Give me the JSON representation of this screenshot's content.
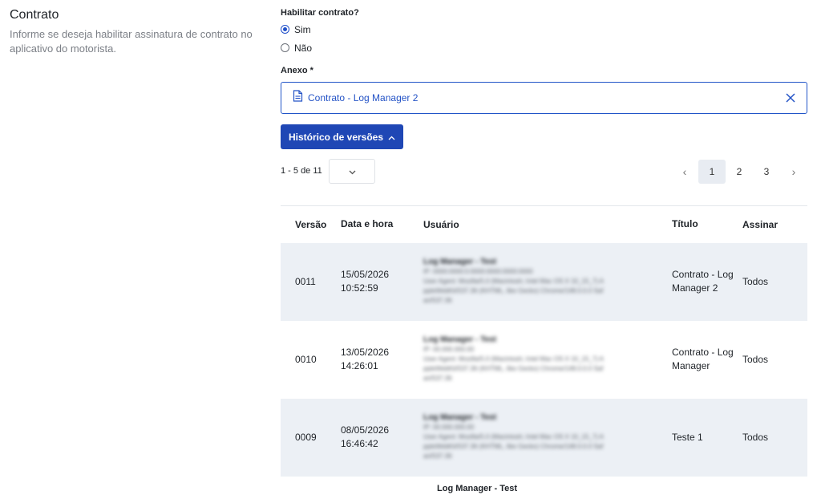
{
  "section": {
    "title": "Contrato",
    "description": "Informe se deseja habilitar assinatura de contrato no aplicativo do motorista."
  },
  "enable": {
    "label": "Habilitar contrato?",
    "options": [
      {
        "label": "Sim",
        "checked": true
      },
      {
        "label": "Não",
        "checked": false
      }
    ]
  },
  "attachment": {
    "label": "Anexo *",
    "file_name": "Contrato - Log Manager 2",
    "icon": "document-icon"
  },
  "history_button": {
    "label": "Histórico de versões",
    "icon": "chevron-up-icon"
  },
  "pagination": {
    "range": "1 - 5 de 11",
    "pages": [
      "1",
      "2",
      "3"
    ],
    "current": "1"
  },
  "table": {
    "headers": [
      "Versão",
      "Data e hora",
      "Usuário",
      "Título",
      "Assinar"
    ],
    "rows": [
      {
        "version": "0011",
        "date": "15/05/2026",
        "time": "10:52:59",
        "user": "Log Manager - Test",
        "user_details": [
          "IP: 0000:0000:0:0000:0000:0000:0000",
          "User Agent: Mozilla/5.0 (Macintosh; Intel Mac OS X 10_15_7) A",
          "ppleWebKit/537.36 (KHTML, like Gecko) Chrome/148.0.0.0 Saf",
          "ari/537.36"
        ],
        "title": "Contrato - Log Manager 2",
        "sign": "Todos"
      },
      {
        "version": "0010",
        "date": "13/05/2026",
        "time": "14:26:01",
        "user": "Log Manager - Test",
        "user_details": [
          "IP: 00.000.000.00",
          "User Agent: Mozilla/5.0 (Macintosh; Intel Mac OS X 10_15_7) A",
          "ppleWebKit/537.36 (KHTML, like Gecko) Chrome/148.0.0.0 Saf",
          "ari/537.36"
        ],
        "title": "Contrato - Log Manager",
        "sign": "Todos"
      },
      {
        "version": "0009",
        "date": "08/05/2026",
        "time": "16:46:42",
        "user": "Log Manager - Test",
        "user_details": [
          "IP: 00.000.000.00",
          "User Agent: Mozilla/5.0 (Macintosh; Intel Mac OS X 10_15_7) A",
          "ppleWebKit/537.36 (KHTML, like Gecko) Chrome/148.0.0.0 Saf",
          "ari/537.36"
        ],
        "title": "Teste 1",
        "sign": "Todos"
      }
    ],
    "partial_row_user": "Log Manager - Test"
  },
  "colors": {
    "accent": "#1f47b5",
    "row_shade": "#ecf0f5"
  }
}
